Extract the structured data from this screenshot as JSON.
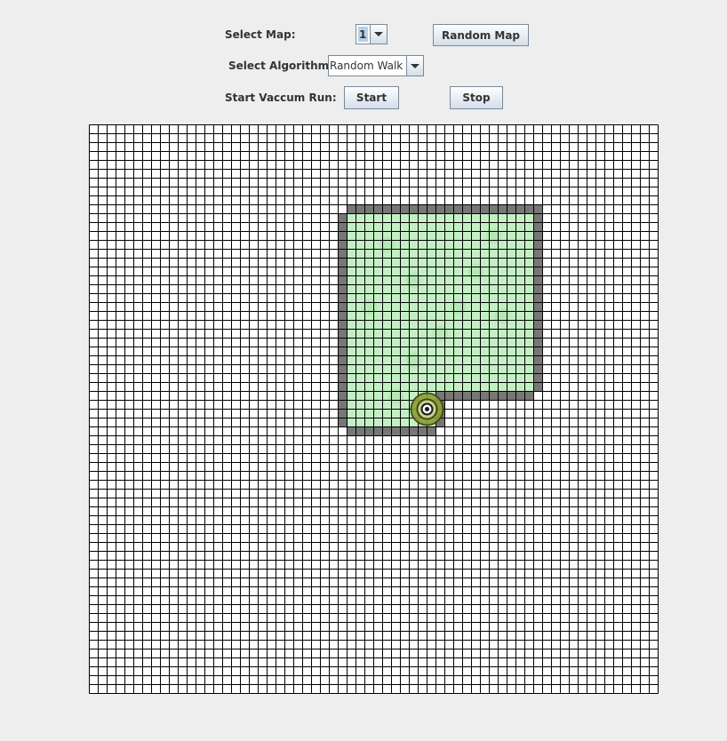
{
  "controls": {
    "map_label": "Select Map:",
    "map_value": "1",
    "random_map_button": "Random Map",
    "algorithm_label": "Select Algorithm:",
    "algorithm_value": "Random Walk",
    "run_label": "Start Vaccum Run:",
    "start_button": "Start",
    "stop_button": "Stop"
  },
  "grid": {
    "cols": 64,
    "rows": 64,
    "colors": {
      "grid_line": "#000000",
      "floor": "#ffffff",
      "wall": "#777777",
      "cleaned": "#c4efc4",
      "cleaned_dark": "#aee2ae"
    },
    "wall_segments": [
      {
        "col_start": 29,
        "col_end": 50,
        "row_start": 9,
        "row_end": 9
      },
      {
        "col_start": 28,
        "col_end": 28,
        "row_start": 10,
        "row_end": 33
      },
      {
        "col_start": 50,
        "col_end": 50,
        "row_start": 10,
        "row_end": 29
      },
      {
        "col_start": 39,
        "col_end": 49,
        "row_start": 30,
        "row_end": 30
      },
      {
        "col_start": 39,
        "col_end": 39,
        "row_start": 31,
        "row_end": 33
      },
      {
        "col_start": 29,
        "col_end": 38,
        "row_start": 34,
        "row_end": 34
      }
    ],
    "cleaned_regions": [
      {
        "col_start": 29,
        "col_end": 49,
        "row_start": 10,
        "row_end": 29
      },
      {
        "col_start": 29,
        "col_end": 38,
        "row_start": 30,
        "row_end": 33
      }
    ],
    "robot": {
      "col": 38,
      "row": 32,
      "icon": "robot-vacuum-icon",
      "colors": {
        "body": "#8e9e3a",
        "ring": "#3d4a12",
        "core": "#1a1a1a"
      }
    }
  }
}
